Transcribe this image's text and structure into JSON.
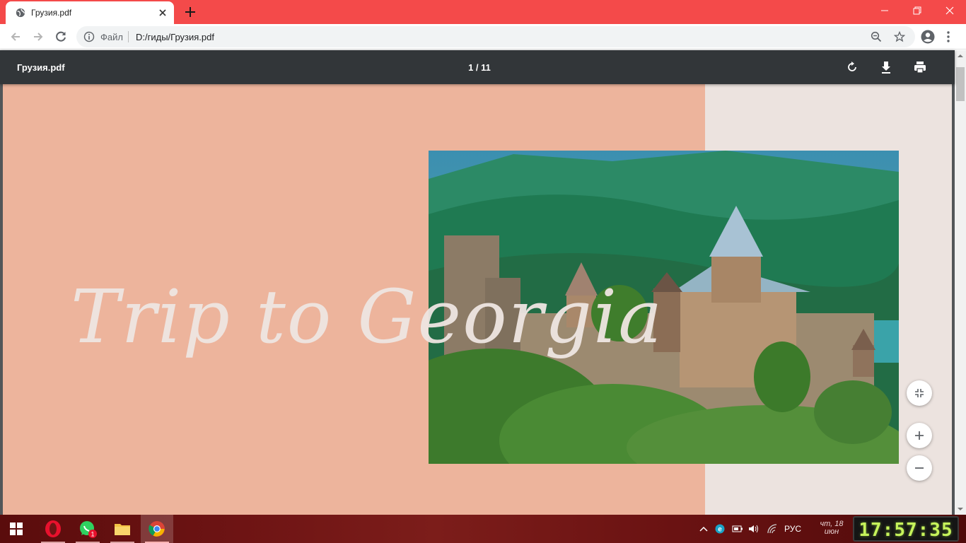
{
  "browser": {
    "tab": {
      "title": "Грузия.pdf",
      "favicon": "globe-icon"
    },
    "omnibox": {
      "scheme_label": "Файл",
      "url": "D:/гиды/Грузия.pdf"
    },
    "colors": {
      "titlebar": "#f44a4a"
    }
  },
  "pdf": {
    "filename": "Грузия.pdf",
    "page_indicator": "1 / 11",
    "page": {
      "cover_title": "Trip to Georgia"
    },
    "colors": {
      "toolbar": "#323639",
      "panel": "#edb49c",
      "page_bg": "#ece3df"
    }
  },
  "taskbar": {
    "apps": [
      "start",
      "opera",
      "whatsapp",
      "file-explorer",
      "chrome"
    ],
    "whatsapp_badge": "1",
    "tray": {
      "language": "РУС",
      "date_line1": "чт, 18",
      "date_line2": "июн"
    },
    "clock": "17:57:35"
  }
}
